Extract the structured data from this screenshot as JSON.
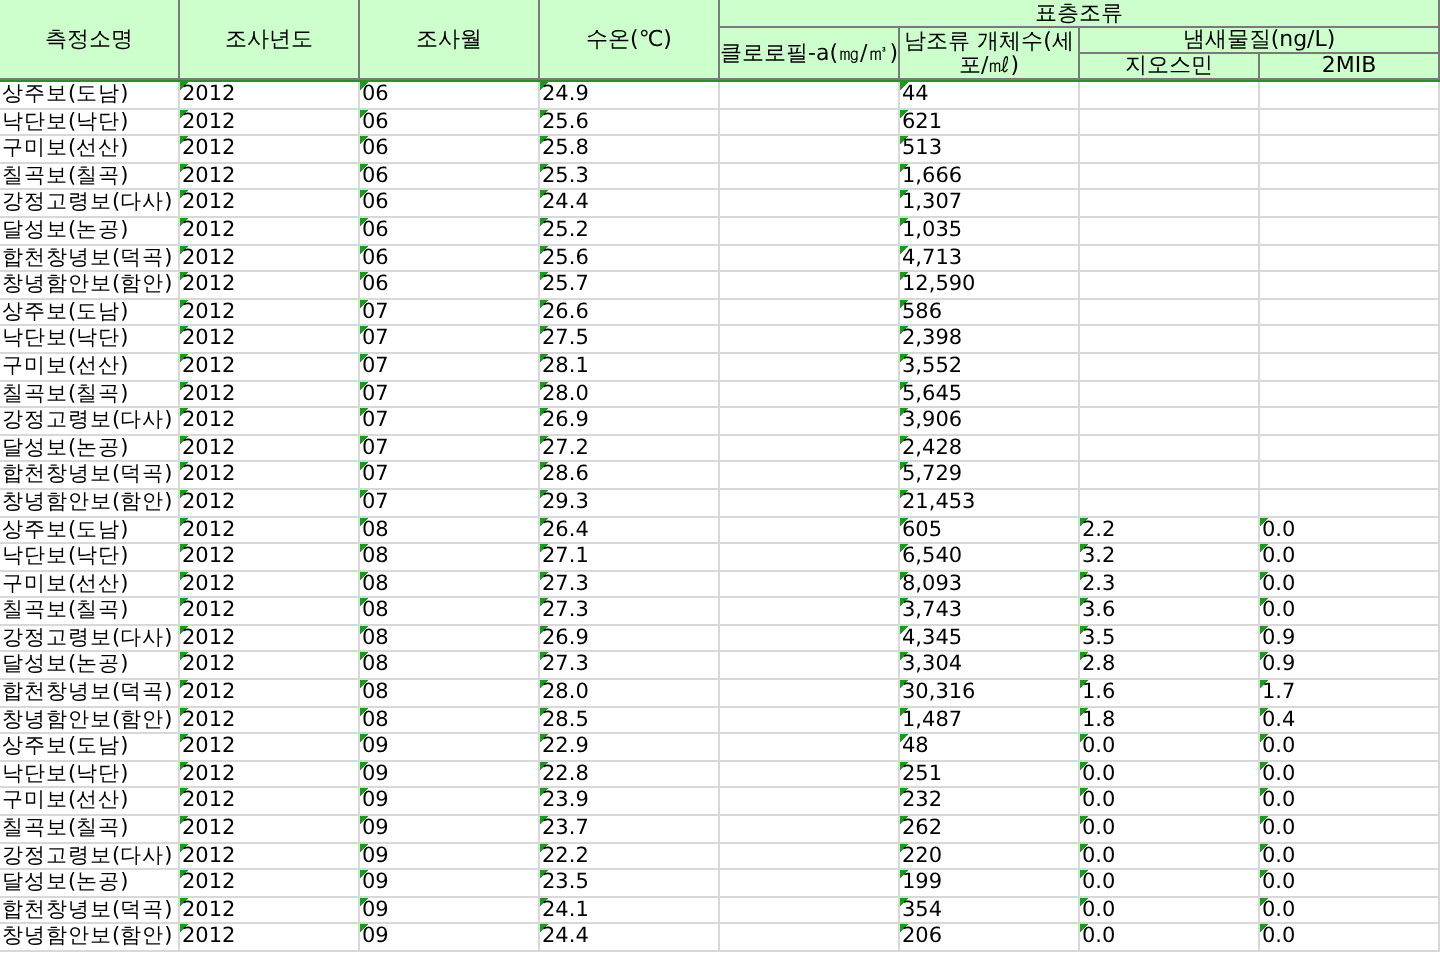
{
  "header": {
    "columns": [
      "측정소명",
      "조사년도",
      "조사월",
      "수온(℃)"
    ],
    "group": {
      "label": "표층조류",
      "columns": [
        {
          "label": "클로로필-a(㎎/㎥)"
        },
        {
          "label": "남조류 개체수(세포/㎖)"
        },
        {
          "label": "냄새물질(ng/L)",
          "children": [
            "지오스민",
            "2MIB"
          ]
        }
      ]
    }
  },
  "rows": [
    {
      "site": "상주보(도남)",
      "year": "2012",
      "month": "06",
      "temp": "24.9",
      "cyano": "44",
      "numbers_stored_as_text": true
    },
    {
      "site": "낙단보(낙단)",
      "year": "2012",
      "month": "06",
      "temp": "25.6",
      "cyano": "621",
      "numbers_stored_as_text": true
    },
    {
      "site": "구미보(선산)",
      "year": "2012",
      "month": "06",
      "temp": "25.8",
      "cyano": "513",
      "numbers_stored_as_text": true
    },
    {
      "site": "칠곡보(칠곡)",
      "year": "2012",
      "month": "06",
      "temp": "25.3",
      "cyano": "1,666",
      "numbers_stored_as_text": true
    },
    {
      "site": "강정고령보(다사)",
      "year": "2012",
      "month": "06",
      "temp": "24.4",
      "cyano": "1,307",
      "numbers_stored_as_text": true
    },
    {
      "site": "달성보(논공)",
      "year": "2012",
      "month": "06",
      "temp": "25.2",
      "cyano": "1,035",
      "numbers_stored_as_text": true
    },
    {
      "site": "합천창녕보(덕곡)",
      "year": "2012",
      "month": "06",
      "temp": "25.6",
      "cyano": "4,713",
      "numbers_stored_as_text": true
    },
    {
      "site": "창녕함안보(함안)",
      "year": "2012",
      "month": "06",
      "temp": "25.7",
      "cyano": "12,590",
      "numbers_stored_as_text": true
    },
    {
      "site": "상주보(도남)",
      "year": "2012",
      "month": "07",
      "temp": "26.6",
      "cyano": "586",
      "numbers_stored_as_text": true
    },
    {
      "site": "낙단보(낙단)",
      "year": "2012",
      "month": "07",
      "temp": "27.5",
      "cyano": "2,398",
      "numbers_stored_as_text": true
    },
    {
      "site": "구미보(선산)",
      "year": "2012",
      "month": "07",
      "temp": "28.1",
      "cyano": "3,552",
      "numbers_stored_as_text": true
    },
    {
      "site": "칠곡보(칠곡)",
      "year": "2012",
      "month": "07",
      "temp": "28.0",
      "cyano": "5,645",
      "numbers_stored_as_text": true
    },
    {
      "site": "강정고령보(다사)",
      "year": "2012",
      "month": "07",
      "temp": "26.9",
      "cyano": "3,906",
      "numbers_stored_as_text": true
    },
    {
      "site": "달성보(논공)",
      "year": "2012",
      "month": "07",
      "temp": "27.2",
      "cyano": "2,428",
      "numbers_stored_as_text": true
    },
    {
      "site": "합천창녕보(덕곡)",
      "year": "2012",
      "month": "07",
      "temp": "28.6",
      "cyano": "5,729",
      "numbers_stored_as_text": true
    },
    {
      "site": "창녕함안보(함안)",
      "year": "2012",
      "month": "07",
      "temp": "29.3",
      "cyano": "21,453",
      "numbers_stored_as_text": true
    },
    {
      "site": "상주보(도남)",
      "year": "2012",
      "month": "08",
      "temp": "26.4",
      "cyano": "605",
      "geosmin": "2.2",
      "mib": "0.0",
      "numbers_stored_as_text": true
    },
    {
      "site": "낙단보(낙단)",
      "year": "2012",
      "month": "08",
      "temp": "27.1",
      "cyano": "6,540",
      "geosmin": "3.2",
      "mib": "0.0",
      "numbers_stored_as_text": true
    },
    {
      "site": "구미보(선산)",
      "year": "2012",
      "month": "08",
      "temp": "27.3",
      "cyano": "8,093",
      "geosmin": "2.3",
      "mib": "0.0",
      "numbers_stored_as_text": true
    },
    {
      "site": "칠곡보(칠곡)",
      "year": "2012",
      "month": "08",
      "temp": "27.3",
      "cyano": "3,743",
      "geosmin": "3.6",
      "mib": "0.0",
      "numbers_stored_as_text": true
    },
    {
      "site": "강정고령보(다사)",
      "year": "2012",
      "month": "08",
      "temp": "26.9",
      "cyano": "4,345",
      "geosmin": "3.5",
      "mib": "0.9",
      "numbers_stored_as_text": true
    },
    {
      "site": "달성보(논공)",
      "year": "2012",
      "month": "08",
      "temp": "27.3",
      "cyano": "3,304",
      "geosmin": "2.8",
      "mib": "0.9",
      "numbers_stored_as_text": true
    },
    {
      "site": "합천창녕보(덕곡)",
      "year": "2012",
      "month": "08",
      "temp": "28.0",
      "cyano": "30,316",
      "geosmin": "1.6",
      "mib": "1.7",
      "numbers_stored_as_text": true
    },
    {
      "site": "창녕함안보(함안)",
      "year": "2012",
      "month": "08",
      "temp": "28.5",
      "cyano": "1,487",
      "geosmin": "1.8",
      "mib": "0.4",
      "numbers_stored_as_text": true
    },
    {
      "site": "상주보(도남)",
      "year": "2012",
      "month": "09",
      "temp": "22.9",
      "cyano": "48",
      "geosmin": "0.0",
      "mib": "0.0",
      "numbers_stored_as_text": true
    },
    {
      "site": "낙단보(낙단)",
      "year": "2012",
      "month": "09",
      "temp": "22.8",
      "cyano": "251",
      "geosmin": "0.0",
      "mib": "0.0",
      "numbers_stored_as_text": true
    },
    {
      "site": "구미보(선산)",
      "year": "2012",
      "month": "09",
      "temp": "23.9",
      "cyano": "232",
      "geosmin": "0.0",
      "mib": "0.0",
      "numbers_stored_as_text": true
    },
    {
      "site": "칠곡보(칠곡)",
      "year": "2012",
      "month": "09",
      "temp": "23.7",
      "cyano": "262",
      "geosmin": "0.0",
      "mib": "0.0",
      "numbers_stored_as_text": true
    },
    {
      "site": "강정고령보(다사)",
      "year": "2012",
      "month": "09",
      "temp": "22.2",
      "cyano": "220",
      "geosmin": "0.0",
      "mib": "0.0",
      "numbers_stored_as_text": true
    },
    {
      "site": "달성보(논공)",
      "year": "2012",
      "month": "09",
      "temp": "23.5",
      "cyano": "199",
      "geosmin": "0.0",
      "mib": "0.0",
      "numbers_stored_as_text": true
    },
    {
      "site": "합천창녕보(덕곡)",
      "year": "2012",
      "month": "09",
      "temp": "24.1",
      "cyano": "354",
      "geosmin": "0.0",
      "mib": "0.0",
      "numbers_stored_as_text": true
    },
    {
      "site": "창녕함안보(함안)",
      "year": "2012",
      "month": "09",
      "temp": "24.4",
      "cyano": "206",
      "geosmin": "0.0",
      "mib": "0.0",
      "numbers_stored_as_text": true
    }
  ]
}
